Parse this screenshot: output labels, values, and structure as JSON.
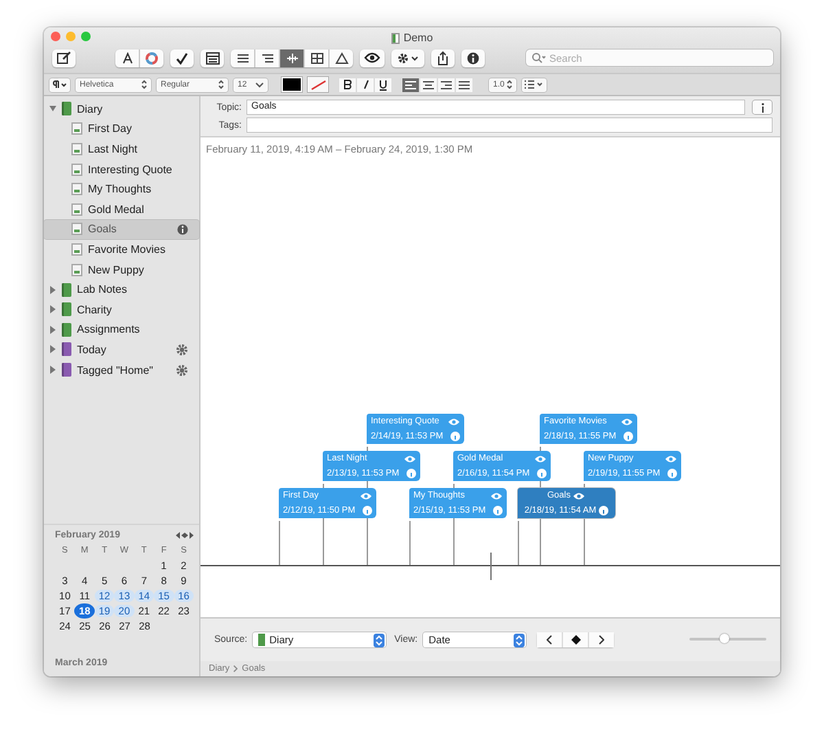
{
  "window": {
    "title": "Demo"
  },
  "toolbar": {
    "view_modes": [
      {
        "selected": false
      },
      {
        "selected": false
      },
      {
        "selected": true
      },
      {
        "selected": false
      },
      {
        "selected": false
      }
    ],
    "search": {
      "placeholder": "Search"
    }
  },
  "format_bar": {
    "font": "Helvetica",
    "style": "Regular",
    "size": "12",
    "line_spacing": "1.0",
    "alignments": [
      {
        "selected": true
      },
      {
        "selected": false
      },
      {
        "selected": false
      },
      {
        "selected": false
      }
    ]
  },
  "sidebar": {
    "items": [
      {
        "label": "Diary",
        "kind": "notebook",
        "expanded": true,
        "selected": false,
        "children": [
          {
            "label": "First Day",
            "kind": "note",
            "selected": false
          },
          {
            "label": "Last Night",
            "kind": "note",
            "selected": false
          },
          {
            "label": "Interesting Quote",
            "kind": "note",
            "selected": false
          },
          {
            "label": "My Thoughts",
            "kind": "note",
            "selected": false
          },
          {
            "label": "Gold Medal",
            "kind": "note",
            "selected": false
          },
          {
            "label": "Goals",
            "kind": "note",
            "selected": true
          },
          {
            "label": "Favorite Movies",
            "kind": "note",
            "selected": false
          },
          {
            "label": "New Puppy",
            "kind": "note",
            "selected": false
          }
        ]
      },
      {
        "label": "Lab Notes",
        "kind": "notebook",
        "expanded": false,
        "selected": false
      },
      {
        "label": "Charity",
        "kind": "notebook",
        "expanded": false,
        "selected": false
      },
      {
        "label": "Assignments",
        "kind": "notebook",
        "expanded": false,
        "selected": false
      },
      {
        "label": "Today",
        "kind": "smart",
        "expanded": false,
        "selected": false
      },
      {
        "label": "Tagged \"Home\"",
        "kind": "smart",
        "expanded": false,
        "selected": false
      }
    ]
  },
  "calendar": {
    "month": "February 2019",
    "weekdays": [
      "S",
      "M",
      "T",
      "W",
      "T",
      "F",
      "S"
    ],
    "weeks": [
      [
        {
          "day": "1",
          "marked": false,
          "selected": false
        },
        {
          "day": "2",
          "marked": false,
          "selected": false
        }
      ],
      [
        {
          "day": "3",
          "marked": false,
          "selected": false
        },
        {
          "day": "4",
          "marked": false,
          "selected": false
        },
        {
          "day": "5",
          "marked": false,
          "selected": false
        },
        {
          "day": "6",
          "marked": false,
          "selected": false
        },
        {
          "day": "7",
          "marked": false,
          "selected": false
        },
        {
          "day": "8",
          "marked": false,
          "selected": false
        },
        {
          "day": "9",
          "marked": false,
          "selected": false
        }
      ],
      [
        {
          "day": "10",
          "marked": false,
          "selected": false
        },
        {
          "day": "11",
          "marked": false,
          "selected": false
        },
        {
          "day": "12",
          "marked": true,
          "selected": false
        },
        {
          "day": "13",
          "marked": true,
          "selected": false
        },
        {
          "day": "14",
          "marked": true,
          "selected": false
        },
        {
          "day": "15",
          "marked": true,
          "selected": false
        },
        {
          "day": "16",
          "marked": true,
          "selected": false
        }
      ],
      [
        {
          "day": "17",
          "marked": false,
          "selected": false
        },
        {
          "day": "18",
          "marked": true,
          "selected": true
        },
        {
          "day": "19",
          "marked": true,
          "selected": false
        },
        {
          "day": "20",
          "marked": true,
          "selected": false
        },
        {
          "day": "21",
          "marked": false,
          "selected": false
        },
        {
          "day": "22",
          "marked": false,
          "selected": false
        },
        {
          "day": "23",
          "marked": false,
          "selected": false
        }
      ],
      [
        {
          "day": "24",
          "marked": false,
          "selected": false
        },
        {
          "day": "25",
          "marked": false,
          "selected": false
        },
        {
          "day": "26",
          "marked": false,
          "selected": false
        },
        {
          "day": "27",
          "marked": false,
          "selected": false
        },
        {
          "day": "28",
          "marked": false,
          "selected": false
        }
      ]
    ],
    "next_month": "March 2019"
  },
  "editor": {
    "topic_label": "Topic:",
    "topic": "Goals",
    "tags_label": "Tags:",
    "date_range": "February 11, 2019, 4:19 AM – February 24, 2019, 1:30 PM"
  },
  "timeline": {
    "events": [
      {
        "title": "First Day",
        "date": "2/12/19, 11:50 PM",
        "selected": false
      },
      {
        "title": "Last Night",
        "date": "2/13/19, 11:53 PM",
        "selected": false
      },
      {
        "title": "Interesting Quote",
        "date": "2/14/19, 11:53 PM",
        "selected": false
      },
      {
        "title": "My Thoughts",
        "date": "2/15/19, 11:53 PM",
        "selected": false
      },
      {
        "title": "Gold Medal",
        "date": "2/16/19, 11:54 PM",
        "selected": false
      },
      {
        "title": "Favorite Movies",
        "date": "2/18/19, 11:55 PM",
        "selected": false
      },
      {
        "title": "Goals",
        "date": "2/18/19, 11:54 AM",
        "selected": true
      },
      {
        "title": "New Puppy",
        "date": "2/19/19, 11:55 PM",
        "selected": false
      }
    ]
  },
  "bottom_bar": {
    "source_label": "Source:",
    "source": "Diary",
    "view_label": "View:",
    "view": "Date",
    "zoom": {
      "level": 0.45
    }
  },
  "path_bar": [
    "Diary",
    "Goals"
  ]
}
